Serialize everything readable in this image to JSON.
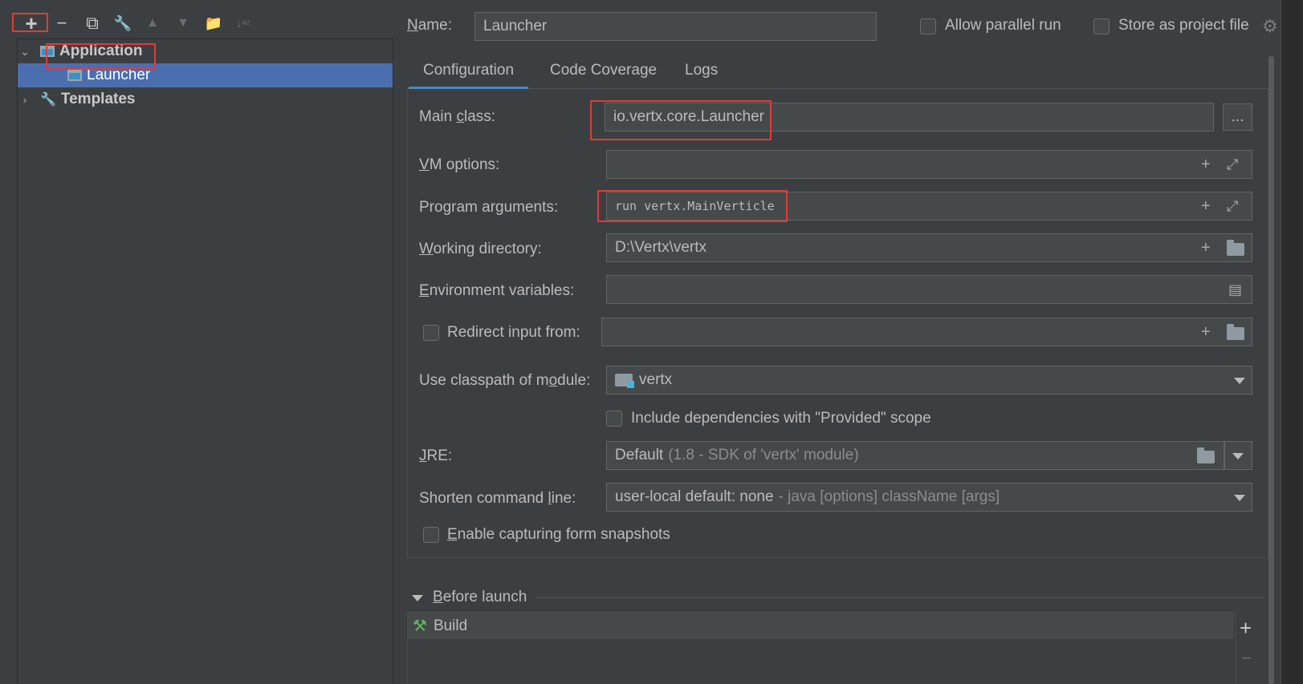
{
  "toolbar": {
    "add": "+",
    "remove": "−",
    "copy": "⧉",
    "edit": "🔧",
    "up": "▲",
    "down": "▼",
    "folder": "📁",
    "sort": "↓ᵃᶻ"
  },
  "tree": {
    "application": "Application",
    "launcher": "Launcher",
    "templates": "Templates"
  },
  "header": {
    "name_label": "Name:",
    "name_value": "Launcher",
    "allow_parallel": "Allow parallel run",
    "store_as_project": "Store as project file"
  },
  "tabs": [
    "Configuration",
    "Code Coverage",
    "Logs"
  ],
  "form": {
    "main_class_label": "Main class:",
    "main_class_value": "io.vertx.core.Launcher",
    "browse": "...",
    "vm_options_label": "VM options:",
    "program_args_label": "Program arguments:",
    "program_args_value": "run vertx.MainVerticle",
    "working_dir_label": "Working directory:",
    "working_dir_value": "D:\\Vertx\\vertx",
    "env_vars_label": "Environment variables:",
    "redirect_label": "Redirect input from:",
    "classpath_label": "Use classpath of module:",
    "classpath_value": "vertx",
    "include_deps_label": "Include dependencies with \"Provided\" scope",
    "jre_label": "JRE:",
    "jre_value": "Default",
    "jre_hint": "(1.8 - SDK of 'vertx' module)",
    "shorten_label": "Shorten command line:",
    "shorten_value": "user-local default: none",
    "shorten_hint": "- java [options] className [args]",
    "enable_snapshots_label": "Enable capturing form snapshots"
  },
  "before_launch": {
    "title": "Before launch",
    "item": "Build",
    "add": "+",
    "remove": "−"
  },
  "icons": [
    "plus-icon",
    "minus-icon",
    "copy-icon",
    "wrench-icon",
    "arrow-up-icon",
    "arrow-down-icon",
    "new-folder-icon",
    "sort-icon",
    "gear-icon",
    "expand-icon",
    "folder-icon",
    "document-icon",
    "hammer-icon",
    "module-folder-icon"
  ],
  "colors": {
    "background": "#3c3f41",
    "field": "#45494a",
    "selection": "#4b6eaf",
    "tab_underline": "#4a88c7",
    "highlight_box": "#e53935"
  }
}
